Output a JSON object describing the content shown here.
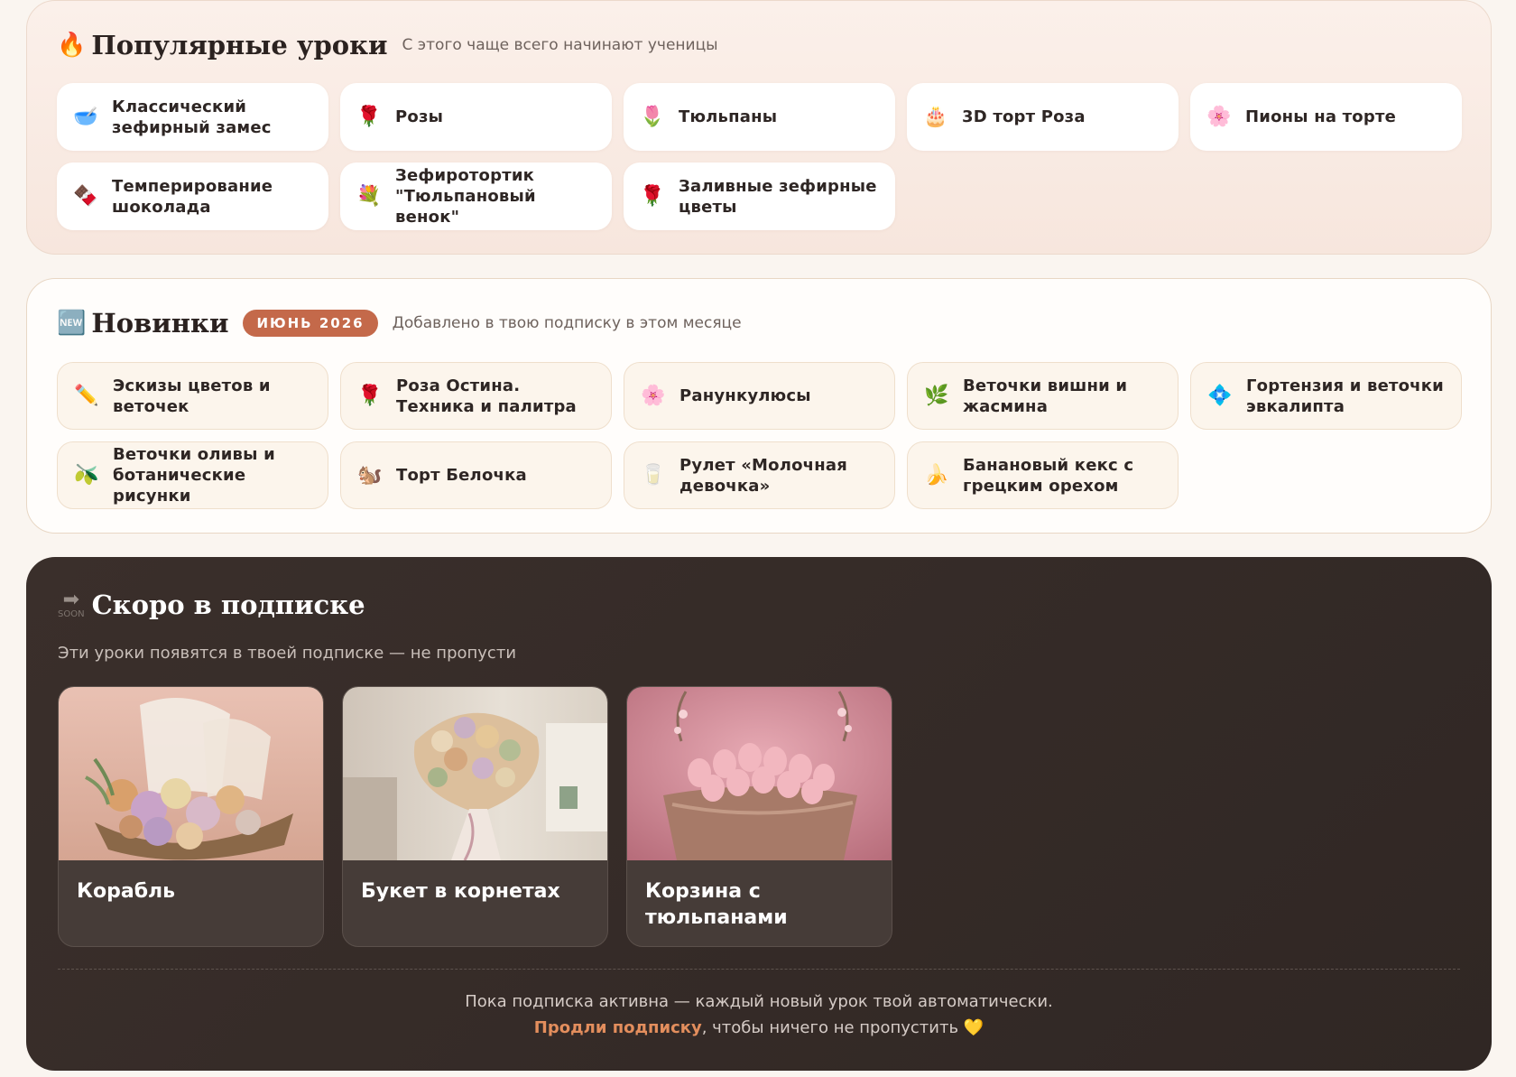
{
  "popular": {
    "icon": "🔥",
    "title": "Популярные уроки",
    "subtitle": "С этого чаще всего начинают ученицы",
    "items": [
      {
        "icon": "🥣",
        "label": "Классический зефирный замес"
      },
      {
        "icon": "🌹",
        "label": "Розы"
      },
      {
        "icon": "🌷",
        "label": "Тюльпаны"
      },
      {
        "icon": "🎂",
        "label": "3D торт Роза"
      },
      {
        "icon": "🌸",
        "label": "Пионы на торте"
      },
      {
        "icon": "🍫",
        "label": "Темперирование шоколада"
      },
      {
        "icon": "💐",
        "label": "Зефиротортик \"Тюльпановый венок\""
      },
      {
        "icon": "🌹",
        "label": "Заливные зефирные цветы"
      }
    ]
  },
  "newest": {
    "icon": "🆕",
    "title": "Новинки",
    "badge": "ИЮНЬ 2026",
    "subtitle": "Добавлено в твою подписку в этом месяце",
    "items": [
      {
        "icon": "✏️",
        "label": "Эскизы цветов и веточек"
      },
      {
        "icon": "🌹",
        "label": "Роза Остина. Техника и палитра"
      },
      {
        "icon": "🌸",
        "label": "Ранункулюсы"
      },
      {
        "icon": "🌿",
        "label": "Веточки вишни и жасмина"
      },
      {
        "icon": "💠",
        "label": "Гортензия и веточки эвкалипта"
      },
      {
        "icon": "🫒",
        "label": "Веточки оливы и ботанические рисунки"
      },
      {
        "icon": "🐿️",
        "label": "Торт Белочка"
      },
      {
        "icon": "🥛",
        "label": "Рулет «Молочная девочка»"
      },
      {
        "icon": "🍌",
        "label": "Банановый кекс с грецким орехом"
      }
    ]
  },
  "soon": {
    "icon_text": "SOON",
    "title": "Скоро в подписке",
    "subtitle": "Эти уроки появятся в твоей подписке — не пропусти",
    "items": [
      {
        "label": "Корабль",
        "image": "ship-bouquet"
      },
      {
        "label": "Букет в корнетах",
        "image": "cornet-bouquet"
      },
      {
        "label": "Корзина с тюльпанами",
        "image": "tulip-basket"
      }
    ],
    "footer_line1": "Пока подписка активна — каждый новый урок твой автоматически.",
    "renew_link": "Продли подписку",
    "footer_line2_rest": ", чтобы ничего не пропустить",
    "heart": "💛"
  }
}
